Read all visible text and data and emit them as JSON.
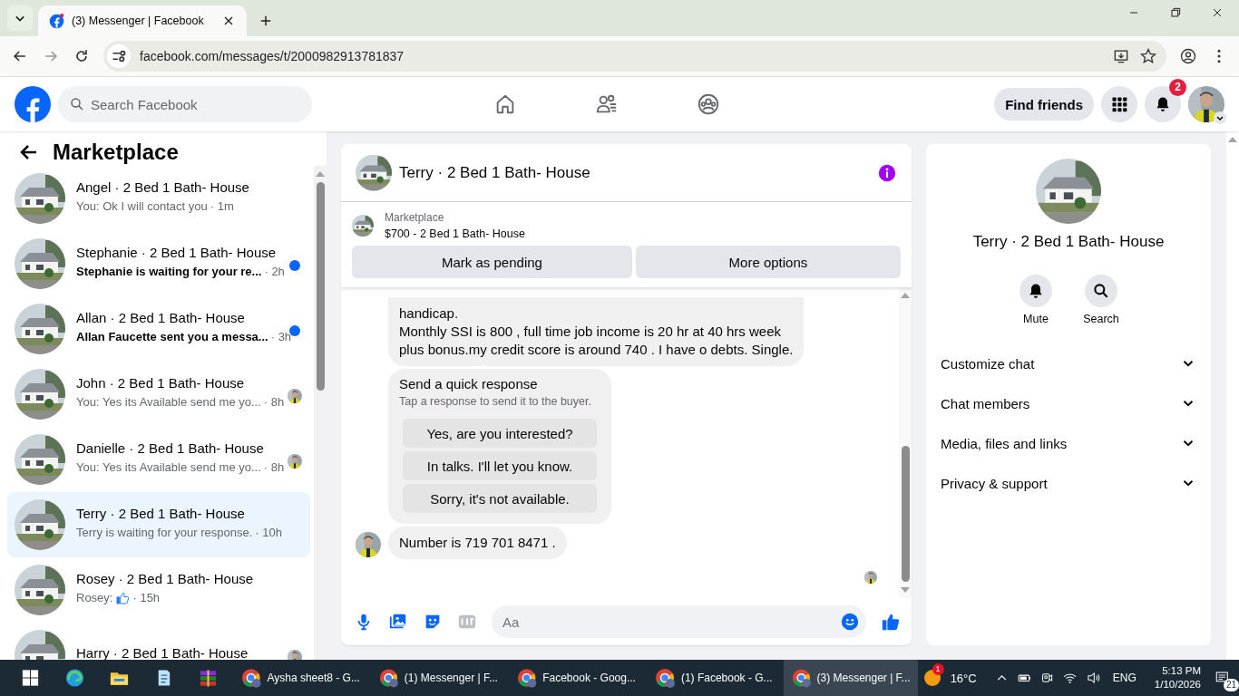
{
  "browser": {
    "tab": {
      "title": "(3) Messenger | Facebook"
    },
    "url": "facebook.com/messages/t/2000982913781837"
  },
  "header": {
    "search": {
      "placeholder": "Search Facebook"
    },
    "find_friends": "Find friends",
    "notifications_badge": "2"
  },
  "sidebar": {
    "title": "Marketplace",
    "conversations": [
      {
        "kind": "text",
        "name": "Angel · 2 Bed 1 Bath- House",
        "preview": "You: Ok I will contact you",
        "time": "· 1m",
        "unread": false,
        "seen": false,
        "selected": false
      },
      {
        "kind": "text",
        "name": "Stephanie · 2 Bed 1 Bath- House",
        "preview": "Stephanie is waiting for your re...",
        "time": "· 2h",
        "unread": true,
        "seen": false,
        "selected": false
      },
      {
        "kind": "text",
        "name": "Allan · 2 Bed 1 Bath- House",
        "preview": "Allan Faucette sent you a messa...",
        "time": "· 3h",
        "unread": true,
        "seen": false,
        "selected": false
      },
      {
        "kind": "text",
        "name": "John · 2 Bed 1 Bath- House",
        "preview": "You: Yes its Available send me yo...",
        "time": "· 8h",
        "unread": false,
        "seen": true,
        "selected": false
      },
      {
        "kind": "text",
        "name": "Danielle · 2 Bed 1 Bath- House",
        "preview": "You: Yes its Available send me yo...",
        "time": "· 8h",
        "unread": false,
        "seen": true,
        "selected": false
      },
      {
        "kind": "text",
        "name": "Terry · 2 Bed 1 Bath- House",
        "preview": "Terry is waiting for your response.",
        "time": "· 10h",
        "unread": false,
        "seen": false,
        "selected": true
      },
      {
        "kind": "like",
        "name": "Rosey · 2 Bed 1 Bath- House",
        "preview": "Rosey:",
        "time": "· 15h",
        "unread": false,
        "seen": false,
        "selected": false
      },
      {
        "kind": "text",
        "name": "Harry · 2 Bed 1 Bath- House",
        "unread": false,
        "seen": true,
        "selected": false
      }
    ]
  },
  "chat": {
    "title": "Terry · 2 Bed 1 Bath- House",
    "listing": {
      "label": "Marketplace",
      "title": "$700 - 2 Bed 1 Bath- House"
    },
    "actions": [
      "Mark as pending",
      "More options"
    ],
    "messages": [
      {
        "kind": "text",
        "avatar": false,
        "text": "handicap.\nMonthly SSI is 800 , full time job income is 20 hr at 40 hrs week\nplus bonus.my credit score is around 740 . I have o debts. Single."
      },
      {
        "kind": "quick_responses",
        "avatar": false,
        "title": "Send a quick response",
        "subtitle": "Tap a response to send it to the buyer.",
        "options": [
          "Yes, are you interested?",
          "In talks. I'll let you know.",
          "Sorry, it's not available."
        ]
      },
      {
        "kind": "text",
        "avatar": true,
        "text": "Number is 719 701 8471 ."
      }
    ],
    "composer": {
      "placeholder": "Aa"
    }
  },
  "info": {
    "title": "Terry · 2 Bed 1 Bath- House",
    "actions": [
      {
        "kind": "mute",
        "label": "Mute"
      },
      {
        "kind": "search",
        "label": "Search"
      }
    ],
    "sections": [
      {
        "label": "Customize chat",
        "expanded": false
      },
      {
        "label": "Chat members",
        "expanded": false
      },
      {
        "label": "Media, files and links",
        "expanded": false
      },
      {
        "label": "Privacy & support",
        "expanded": false
      }
    ]
  },
  "taskbar": {
    "items": [
      {
        "label": "Aysha sheet8 - G...",
        "selected": false
      },
      {
        "label": "(1) Messenger | F...",
        "selected": false
      },
      {
        "label": "Facebook - Goog...",
        "selected": false
      },
      {
        "label": "(1) Facebook - G...",
        "selected": false
      },
      {
        "label": "(3) Messenger | F...",
        "selected": true
      }
    ],
    "weather": {
      "badge": "1",
      "temperature": "16°C"
    },
    "language": "ENG",
    "time": "5:13 PM",
    "date": "1/10/2026",
    "notifications": "21"
  }
}
